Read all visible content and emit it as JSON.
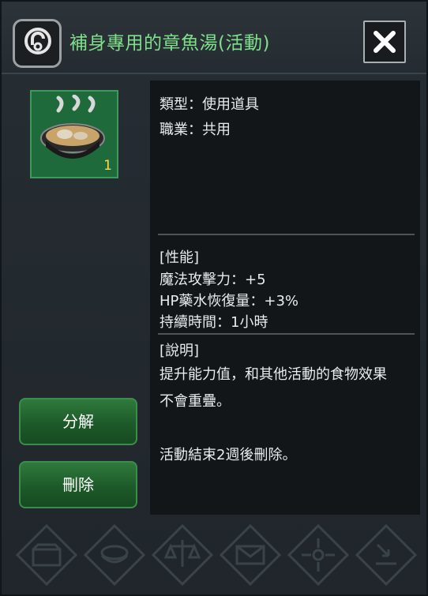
{
  "title": "補身專用的章魚湯(活動)",
  "item": {
    "quantity": "1"
  },
  "info": {
    "type": "類型：使用道具",
    "job": "職業：共用",
    "stats_header": "[性能]",
    "stats": [
      "魔法攻擊力：+5",
      "HP藥水恢復量：+3%",
      "持續時間：1小時"
    ],
    "desc_header": "[說明]",
    "desc_lines": [
      "提升能力值，和其他活動的食物效果",
      "不會重疊。",
      "活動結束2週後刪除。"
    ]
  },
  "buttons": {
    "disassemble": "分解",
    "delete": "刪除"
  },
  "icons": [
    "lock-icon",
    "close-icon",
    "storage-icon",
    "food-icon",
    "scale-icon",
    "mail-icon",
    "move-icon",
    "download-icon"
  ],
  "colors": {
    "title": "#7ee08a",
    "quantity": "#ffd84a",
    "button": "#1d5a29"
  }
}
